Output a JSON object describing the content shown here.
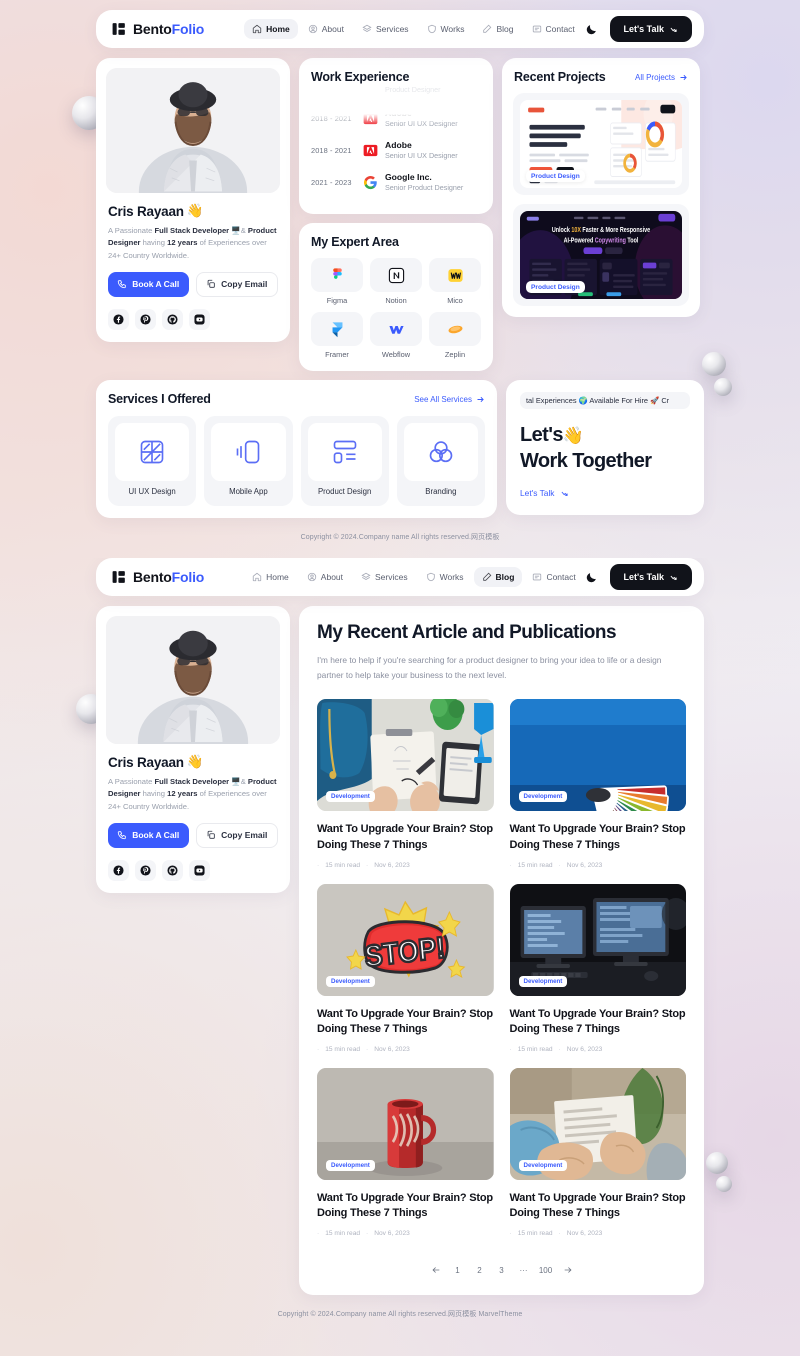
{
  "brand": {
    "part1": "Bento",
    "part2": "Folio"
  },
  "nav": {
    "items": [
      {
        "label": "Home",
        "icon": "home-icon"
      },
      {
        "label": "About",
        "icon": "user-circle-icon"
      },
      {
        "label": "Services",
        "icon": "layers-icon"
      },
      {
        "label": "Works",
        "icon": "shield-icon"
      },
      {
        "label": "Blog",
        "icon": "pen-icon"
      },
      {
        "label": "Contact",
        "icon": "message-icon"
      }
    ],
    "active_home": "Home",
    "active_blog": "Blog",
    "cta_label": "Let's Talk",
    "theme_toggle": "moon-icon"
  },
  "profile": {
    "name": "Cris Rayaan",
    "name_emoji": "👋",
    "bio_1": "A Passionate ",
    "bio_b1": "Full Stack Developer",
    "bio_2": " 🖥️& ",
    "bio_b2": "Product Designer",
    "bio_3": " having ",
    "bio_b3": "12 years",
    "bio_4": " of Experiences over 24+ Country Worldwide.",
    "book_call": "Book A Call",
    "copy_email": "Copy Email",
    "socials": [
      "facebook-icon",
      "pinterest-icon",
      "github-icon",
      "youtube-icon"
    ]
  },
  "work_experience": {
    "title": "Work Experience",
    "faded_role": "Product Designer",
    "rows": [
      {
        "years": "2018 - 2021",
        "company": "Adobe",
        "role": "Senior UI UX Designer",
        "logo": "adobe-logo"
      },
      {
        "years": "2018 - 2021",
        "company": "Adobe",
        "role": "Senior UI UX Designer",
        "logo": "adobe-logo"
      },
      {
        "years": "2021 - 2023",
        "company": "Google Inc.",
        "role": "Senior Product Designer",
        "logo": "google-logo"
      }
    ]
  },
  "expert_area": {
    "title": "My Expert Area",
    "items": [
      {
        "label": "Figma",
        "icon": "figma-logo"
      },
      {
        "label": "Notion",
        "icon": "notion-logo"
      },
      {
        "label": "Mico",
        "icon": "mico-logo"
      },
      {
        "label": "Framer",
        "icon": "framer-logo"
      },
      {
        "label": "Webflow",
        "icon": "webflow-logo"
      },
      {
        "label": "Zeplin",
        "icon": "zeplin-logo"
      }
    ]
  },
  "recent_projects": {
    "title": "Recent Projects",
    "link": "All Projects",
    "items": [
      {
        "tag": "Product Design",
        "headline": "Your Ultimate 📧 Email Marketing & Automation Solution is Here"
      },
      {
        "tag": "Product Design",
        "headline": "Unlock 10X Faster & More Responsive AI-Powered Copywriting Tool"
      }
    ]
  },
  "services": {
    "title": "Services I Offered",
    "link": "See All Services",
    "items": [
      {
        "label": "UI UX Design",
        "icon": "ui-ux-icon"
      },
      {
        "label": "Mobile App",
        "icon": "mobile-icon"
      },
      {
        "label": "Product Design",
        "icon": "product-icon"
      },
      {
        "label": "Branding",
        "icon": "branding-icon"
      }
    ]
  },
  "work_together": {
    "marquee": "tal Experiences 🌍 Available For Hire 🚀 Cr",
    "title_line1": "Let's",
    "title_emoji": "👋",
    "title_line2": "Work Together",
    "link": "Let's Talk"
  },
  "footer": {
    "copyright_home": "Copyright © 2024.Company name All rights reserved.网页模板",
    "copyright_blog": "Copyright © 2024.Company name All rights reserved.网页模板 MarvelTheme"
  },
  "blog": {
    "title": "My Recent Article and Publications",
    "subtitle": "I'm here to help if you're searching for a product designer to bring your idea to life or a design partner to help take your business to the next level.",
    "posts": [
      {
        "tag": "Development",
        "title": "Want To Upgrade Your Brain? Stop Doing These 7 Things",
        "read": "15 min read",
        "date": "Nov 6, 2023",
        "image": "desk-sketching-photo"
      },
      {
        "tag": "Development",
        "title": "Want To Upgrade Your Brain? Stop Doing These 7 Things",
        "read": "15 min read",
        "date": "Nov 6, 2023",
        "image": "color-swatches-photo"
      },
      {
        "tag": "Development",
        "title": "Want To Upgrade Your Brain? Stop Doing These 7 Things",
        "read": "15 min read",
        "date": "Nov 6, 2023",
        "image": "stop-sticker-photo"
      },
      {
        "tag": "Development",
        "title": "Want To Upgrade Your Brain? Stop Doing These 7 Things",
        "read": "15 min read",
        "date": "Nov 6, 2023",
        "image": "dark-monitors-photo"
      },
      {
        "tag": "Development",
        "title": "Want To Upgrade Your Brain? Stop Doing These 7 Things",
        "read": "15 min read",
        "date": "Nov 6, 2023",
        "image": "red-mug-photo"
      },
      {
        "tag": "Development",
        "title": "Want To Upgrade Your Brain? Stop Doing These 7 Things",
        "read": "15 min read",
        "date": "Nov 6, 2023",
        "image": "hands-paper-photo"
      }
    ],
    "pagination": {
      "prev": "←",
      "pages": [
        "1",
        "2",
        "3"
      ],
      "ellipsis": "···",
      "last": "100",
      "next": "→"
    }
  },
  "colors": {
    "accent": "#3b5bfd",
    "dark": "#11131a",
    "muted": "#9aa0ad"
  }
}
